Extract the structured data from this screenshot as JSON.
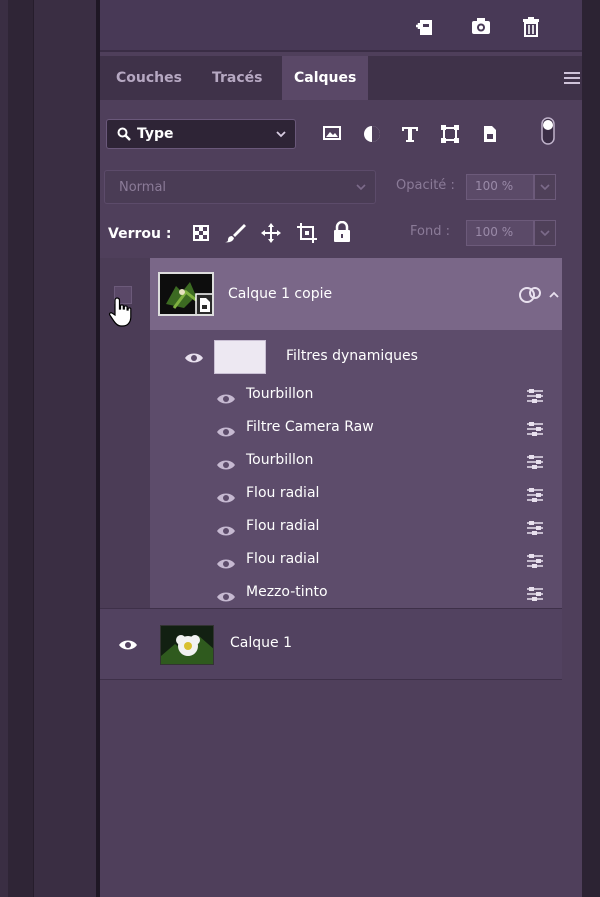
{
  "tabs": [
    {
      "label": "Couches"
    },
    {
      "label": "Tracés"
    },
    {
      "label": "Calques",
      "active": true
    }
  ],
  "filter": {
    "kind_label": "Type"
  },
  "blend": {
    "mode": "Normal",
    "opacity_label": "Opacité :",
    "opacity_value": "100 %"
  },
  "lock": {
    "label": "Verrou :",
    "fill_label": "Fond :",
    "fill_value": "100 %"
  },
  "layers": {
    "top": {
      "name": "Calque 1 copie"
    },
    "filters_header": "Filtres dynamiques",
    "filters": [
      {
        "name": "Tourbillon"
      },
      {
        "name": "Filtre Camera Raw"
      },
      {
        "name": "Tourbillon"
      },
      {
        "name": "Flou radial"
      },
      {
        "name": "Flou radial"
      },
      {
        "name": "Flou radial"
      },
      {
        "name": "Mezzo-tinto"
      }
    ],
    "bottom": {
      "name": "Calque 1"
    }
  },
  "colors": {
    "panel": "#4f3f5b",
    "selected_layer": "#7a6788",
    "filter_block": "#5d4c6b",
    "active_tab": "#5a4867"
  },
  "icons": [
    "new-layer-icon",
    "camera-icon",
    "trash-icon",
    "panel-menu-icon",
    "search-icon",
    "chevron-down-icon",
    "image-filter-icon",
    "adjustment-filter-icon",
    "text-filter-icon",
    "shape-filter-icon",
    "smart-object-filter-icon",
    "filter-toggle-icon",
    "lock-pixels-icon",
    "lock-brush-icon",
    "lock-move-icon",
    "lock-artboard-icon",
    "lock-all-icon",
    "eye-icon",
    "smart-filter-adjust-icon",
    "link-icon",
    "collapse-icon",
    "hand-cursor-icon"
  ]
}
